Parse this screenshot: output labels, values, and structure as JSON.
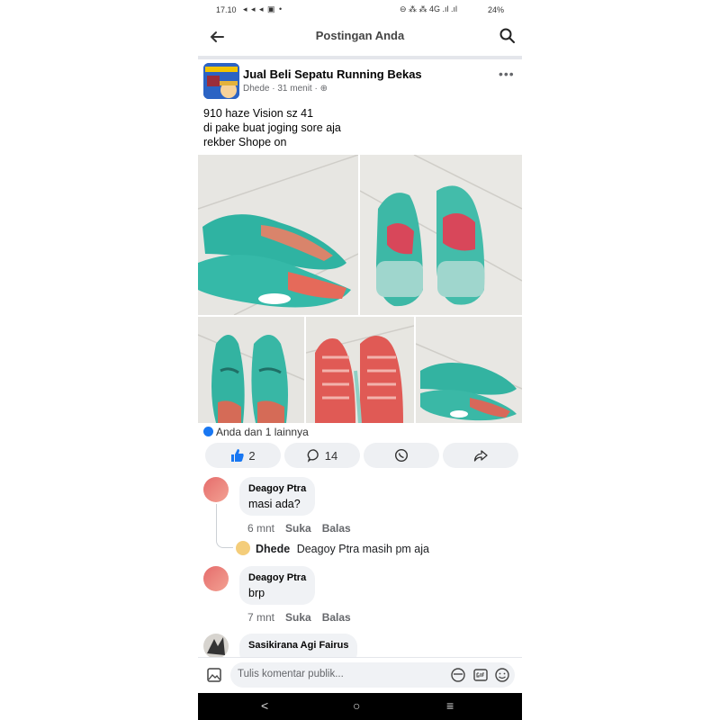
{
  "status": {
    "time": "17.10",
    "icons_left": "◂ ◂ ◂ ▣ •",
    "icons_right": "⊖ ⁂ ⁂ 4G .ıl .ıl",
    "battery": "24%"
  },
  "header": {
    "title": "Postingan Anda"
  },
  "post": {
    "group": "Jual Beli Sepatu Running Bekas",
    "author": "Dhede",
    "time": "31 menit",
    "lines": [
      "910 haze Vision sz 41",
      "di pake buat joging sore aja",
      "rekber Shope on"
    ],
    "reactions": "Anda dan 1 lainnya"
  },
  "actions": {
    "likes": "2",
    "comments": "14"
  },
  "comments": [
    {
      "name": "Deagoy Ptra",
      "text": "masi ada?",
      "time": "6 mnt",
      "like": "Suka",
      "reply": "Balas"
    },
    {
      "name": "Deagoy Ptra",
      "text": "brp",
      "time": "7 mnt",
      "like": "Suka",
      "reply": "Balas"
    },
    {
      "name": "Sasikirana Agi Fairus"
    }
  ],
  "reply": {
    "name": "Dhede",
    "text": "Deagoy Ptra masih pm aja"
  },
  "composer": {
    "placeholder": "Tulis komentar publik..."
  },
  "colors": {
    "accent": "#1877f2",
    "shoe_teal": "#2fb3a2",
    "sole_red": "#e05a55"
  }
}
